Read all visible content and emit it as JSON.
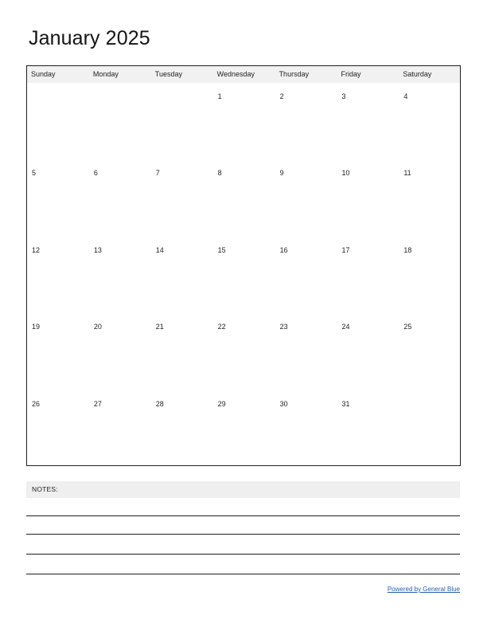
{
  "document": {
    "title": "January 2025",
    "month": "January",
    "year": "2025"
  },
  "calendar": {
    "weekday_headers": [
      "Sunday",
      "Monday",
      "Tuesday",
      "Wednesday",
      "Thursday",
      "Friday",
      "Saturday"
    ],
    "weeks": [
      [
        "",
        "",
        "",
        "1",
        "2",
        "3",
        "4"
      ],
      [
        "5",
        "6",
        "7",
        "8",
        "9",
        "10",
        "11"
      ],
      [
        "12",
        "13",
        "14",
        "15",
        "16",
        "17",
        "18"
      ],
      [
        "19",
        "20",
        "21",
        "22",
        "23",
        "24",
        "25"
      ],
      [
        "26",
        "27",
        "28",
        "29",
        "30",
        "31",
        ""
      ]
    ]
  },
  "notes": {
    "label": "NOTES:",
    "line_count": 4
  },
  "footer": {
    "link_text": "Powered by General Blue"
  },
  "colors": {
    "header_background": "#f1f1f1",
    "notes_background": "#efefef",
    "border": "#1f1f1f",
    "text": "#1f1f1f",
    "link": "#2a5db0",
    "page_background": "#ffffff"
  }
}
